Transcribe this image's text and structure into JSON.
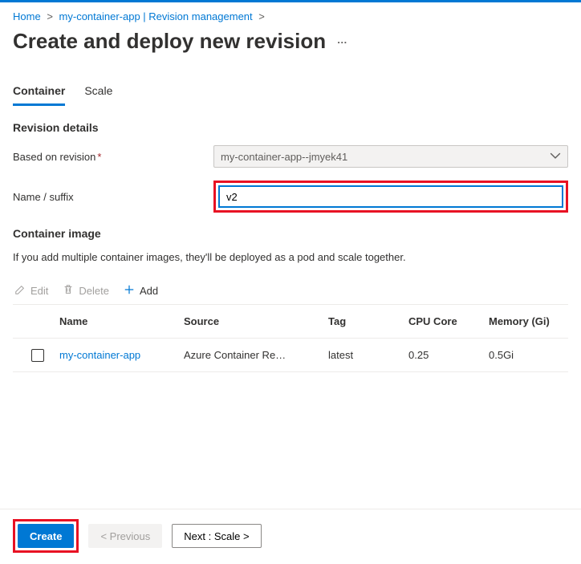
{
  "breadcrumb": {
    "home": "Home",
    "app": "my-container-app | Revision management"
  },
  "page": {
    "title": "Create and deploy new revision",
    "more": "…"
  },
  "tabs": {
    "container": "Container",
    "scale": "Scale"
  },
  "revision": {
    "section_title": "Revision details",
    "based_label": "Based on revision",
    "based_value": "my-container-app--jmyek41",
    "suffix_label": "Name / suffix",
    "suffix_value": "v2"
  },
  "image": {
    "section_title": "Container image",
    "desc": "If you add multiple container images, they'll be deployed as a pod and scale together."
  },
  "toolbar": {
    "edit": "Edit",
    "delete": "Delete",
    "add": "Add"
  },
  "table": {
    "headers": {
      "name": "Name",
      "source": "Source",
      "tag": "Tag",
      "cpu": "CPU Core",
      "mem": "Memory (Gi)"
    },
    "rows": [
      {
        "name": "my-container-app",
        "source": "Azure Container Re…",
        "tag": "latest",
        "cpu": "0.25",
        "mem": "0.5Gi"
      }
    ]
  },
  "footer": {
    "create": "Create",
    "previous": "< Previous",
    "next": "Next : Scale >"
  }
}
